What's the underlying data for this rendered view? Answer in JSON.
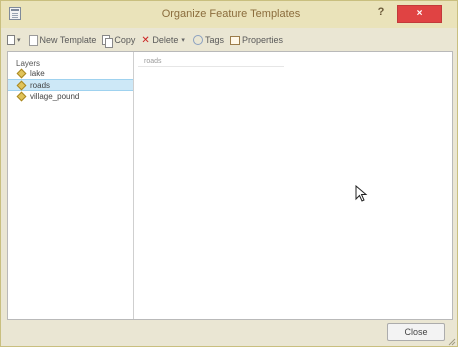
{
  "window": {
    "title": "Organize Feature Templates",
    "help": "?",
    "close_glyph": "×"
  },
  "toolbar": {
    "new_template": "New Template",
    "copy": "Copy",
    "delete": "Delete",
    "tags": "Tags",
    "properties": "Properties"
  },
  "sidebar": {
    "header": "Layers",
    "items": [
      {
        "label": "lake",
        "selected": false
      },
      {
        "label": "roads",
        "selected": true
      },
      {
        "label": "village_pound",
        "selected": false
      }
    ]
  },
  "main": {
    "template_header": "roads"
  },
  "footer": {
    "close_label": "Close"
  },
  "icons": {
    "app": "window-icon",
    "layer": "diamond-layer-icon"
  },
  "colors": {
    "title_bar": "#eae3ba",
    "close_red": "#e04343",
    "selection": "#cde8f7"
  }
}
